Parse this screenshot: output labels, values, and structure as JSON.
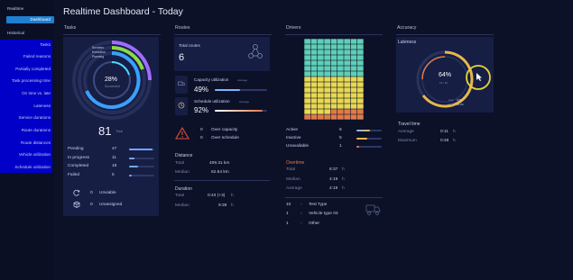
{
  "sidebar": {
    "title": "Realtime",
    "active": "Dashboard",
    "historical": "Historical",
    "items": [
      "Tasks",
      "Failed reasons",
      "Partially completed",
      "Task processing time",
      "On time vs. late",
      "Lateness",
      "Service durations",
      "Route durations",
      "Route distances",
      "Vehicle utilization",
      "Schedule utilization"
    ]
  },
  "header": {
    "title": "Realtime Dashboard - Today"
  },
  "columns": {
    "tasks": "Tasks",
    "routes": "Routes",
    "drivers": "Drivers",
    "accuracy": "Accuracy"
  },
  "tasks": {
    "legend": [
      "Success",
      "Execution",
      "Planning"
    ],
    "donut_pct": "28%",
    "donut_label": "Succeeded",
    "total_value": "81",
    "total_label": "Total",
    "rows": [
      {
        "label": "Pending",
        "value": "47",
        "fraction": 0.58,
        "color": "#6fa8ff"
      },
      {
        "label": "In progress",
        "value": "11",
        "fraction": 0.14,
        "color": "#6fa8ff"
      },
      {
        "label": "Completed",
        "value": "18",
        "fraction": 0.22,
        "color": "#6fa8ff"
      },
      {
        "label": "Failed",
        "value": "5",
        "fraction": 0.06,
        "color": "#6fa8ff"
      }
    ],
    "unviable_value": "0",
    "unviable_label": "Unviable",
    "unassigned_value": "0",
    "unassigned_label": "Unassigned"
  },
  "routes": {
    "total_label": "Total routes",
    "total_value": "6",
    "capacity_label": "Capacity utilization",
    "capacity_avg": "Average",
    "capacity_value": "49%",
    "capacity_fraction": 0.49,
    "schedule_label": "Schedule utilization",
    "schedule_avg": "Average",
    "schedule_value": "92%",
    "schedule_fraction": 0.92,
    "over_capacity_value": "0",
    "over_capacity_label": "Over capacity",
    "over_schedule_value": "0",
    "over_schedule_label": "Over schedule",
    "distance_title": "Distance",
    "distance_total_label": "Total",
    "distance_total_value": "409.31 km",
    "distance_median_label": "Median",
    "distance_median_value": "62.64 km",
    "duration_title": "Duration",
    "duration_total_label": "Total",
    "duration_total_value": "0:43 (+3)",
    "duration_total_unit": "h",
    "duration_median_label": "Median",
    "duration_median_value": "9:39",
    "duration_median_unit": "h"
  },
  "drivers": {
    "active_label": "Active",
    "active_value": "6",
    "inactive_label": "Inactive",
    "inactive_value": "5",
    "unavailable_label": "Unavailable",
    "unavailable_value": "1",
    "overtime_title": "Overtime",
    "ot_total_label": "Total",
    "ot_total_value": "8:37",
    "ot_total_unit": "h",
    "ot_median_label": "Median",
    "ot_median_value": "4:19",
    "ot_median_unit": "h",
    "ot_avg_label": "Average",
    "ot_avg_value": "4:19",
    "ot_avg_unit": "h",
    "vehicles": [
      {
        "count": "10",
        "name": "Test Type"
      },
      {
        "count": "1",
        "name": "Vehicle type 03"
      },
      {
        "count": "1",
        "name": "Other"
      }
    ],
    "grid_colors": {
      "teal": "#5fcfb8",
      "yellow": "#e8d852",
      "orange": "#e07a4a"
    }
  },
  "accuracy": {
    "lateness_title": "Lateness",
    "lateness_pct": "64%",
    "lateness_ratio": "16 / 81",
    "avg_label": "Avg",
    "avg_value": "0:05",
    "max_label": "Max",
    "max_value": "14:06",
    "travel_title": "Travel time",
    "travel_avg_label": "Average",
    "travel_avg_value": "0:11",
    "travel_avg_unit": "h",
    "travel_max_label": "Maximum",
    "travel_max_value": "0:48",
    "travel_max_unit": "h"
  }
}
